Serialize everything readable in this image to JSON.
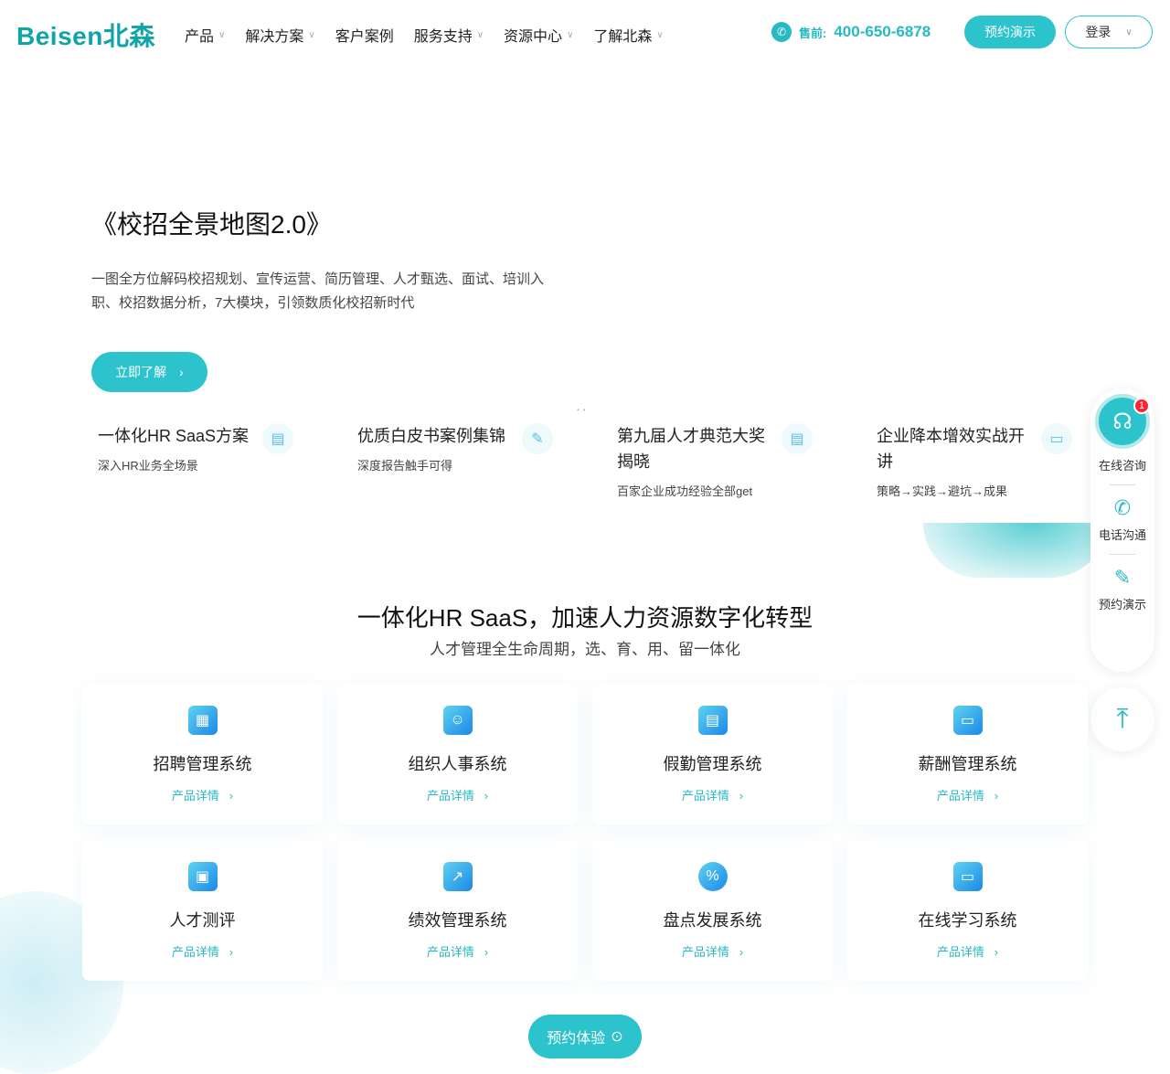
{
  "header": {
    "logo": "Beisen北森",
    "nav": [
      {
        "label": "产品",
        "dropdown": true
      },
      {
        "label": "解决方案",
        "dropdown": true
      },
      {
        "label": "客户案例",
        "dropdown": false
      },
      {
        "label": "服务支持",
        "dropdown": true
      },
      {
        "label": "资源中心",
        "dropdown": true
      },
      {
        "label": "了解北森",
        "dropdown": true
      }
    ],
    "phone_label": "售前:",
    "phone": "400-650-6878",
    "demo": "预约演示",
    "login": "登录"
  },
  "hero": {
    "title": "《校招全景地图2.0》",
    "desc": "一图全方位解码校招规划、宣传运营、简历管理、人才甄选、面试、培训入职、校招数据分析，7大模块，引领数质化校招新时代",
    "button": "立即了解"
  },
  "features": [
    {
      "title": "一体化HR SaaS方案",
      "sub": "深入HR业务全场景"
    },
    {
      "title": "优质白皮书案例集锦",
      "sub": "深度报告触手可得"
    },
    {
      "title": "第九届人才典范大奖揭晓",
      "sub": "百家企业成功经验全部get"
    },
    {
      "title": "企业降本增效实战开讲",
      "sub": "策略→实践→避坑→成果"
    }
  ],
  "side": {
    "chat": "在线咨询",
    "badge": "1",
    "phone": "电话沟通",
    "demo": "预约演示"
  },
  "section": {
    "title": "一体化HR SaaS，加速人力资源数字化转型",
    "subtitle": "人才管理全生命周期，选、育、用、留一体化",
    "detail": "产品详情",
    "products": [
      "招聘管理系统",
      "组织人事系统",
      "假勤管理系统",
      "薪酬管理系统",
      "人才测评",
      "绩效管理系统",
      "盘点发展系统",
      "在线学习系统"
    ],
    "cta": "预约体验"
  }
}
